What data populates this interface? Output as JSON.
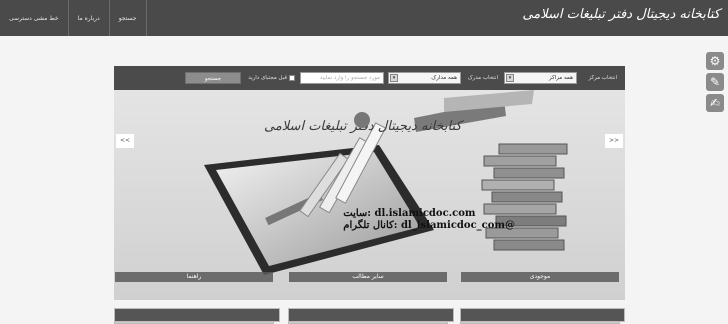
{
  "header": {
    "logo": "کتابخانه دیجیتال دفتر تبلیغات اسلامی",
    "nav": [
      {
        "label": "جستجو"
      },
      {
        "label": "درباره ما"
      },
      {
        "label": "خط مشی دسترسی"
      }
    ]
  },
  "search": {
    "center_label": "انتخاب مرکز",
    "center_value": "همه مراکز",
    "source_label": "انتخاب مدرک",
    "source_value": "همه مدارک",
    "query_placeholder": "مورد جستجو را وارد نمایید",
    "prev_search_label": "قبل مجتبای دارید",
    "submit_label": "جستجو"
  },
  "banner": {
    "title_art": "کتابخانه دیجیتال دفتر تبلیغات اسلامی",
    "site_line": "سایت: dl.islamicdoc.com",
    "telegram_line": "کانال تلگرام: dl_islamicdoc_com@",
    "prev_label": "<<",
    "next_label": ">>"
  },
  "cards": [
    {
      "label": "موجودی"
    },
    {
      "label": "سایر مطالب"
    },
    {
      "label": "راهنما"
    }
  ],
  "icons": [
    "gear-icon",
    "wrench-icon",
    "edit-icon"
  ],
  "colors": {
    "topbar": "#4a4a4a",
    "searchbar": "#4b4b4b",
    "button": "#8d8d8d"
  }
}
